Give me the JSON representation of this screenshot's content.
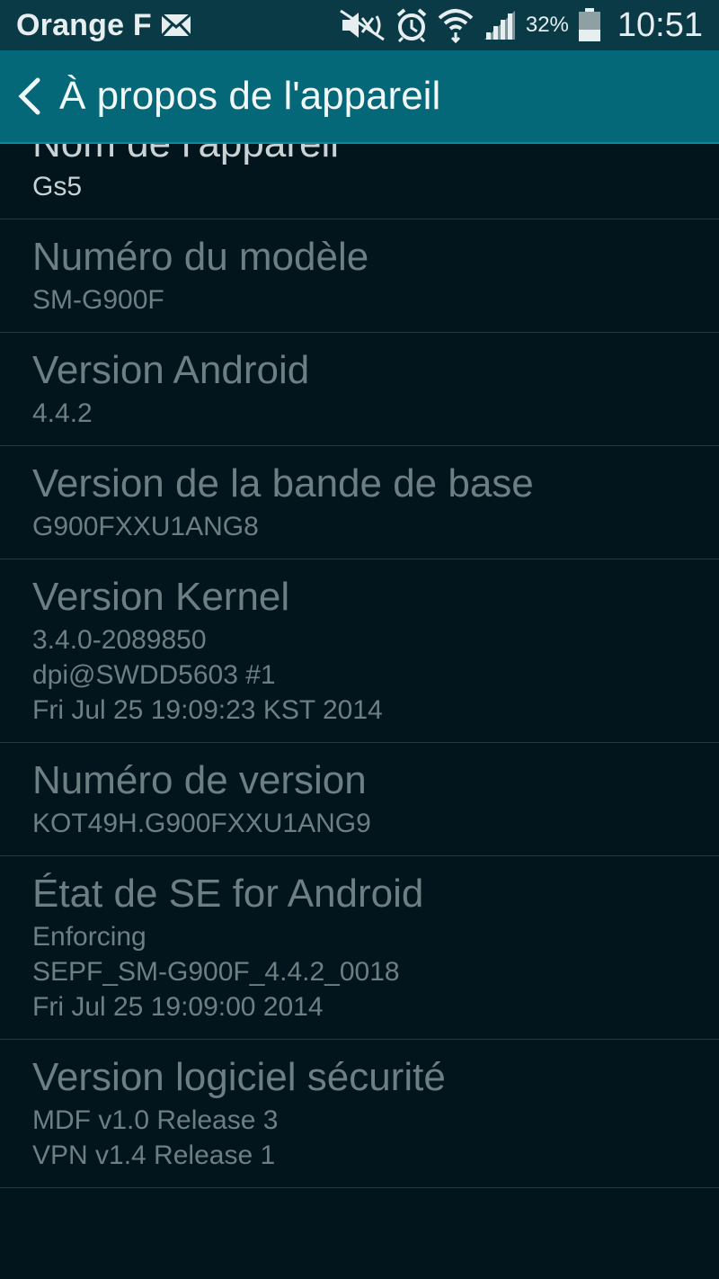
{
  "status_bar": {
    "carrier": "Orange F",
    "battery_percent": "32%",
    "time": "10:51",
    "icons": [
      "mail-icon",
      "mute-icon",
      "alarm-icon",
      "wifi-icon",
      "signal-icon",
      "battery-icon"
    ]
  },
  "app_bar": {
    "title": "À propos de l'appareil",
    "back_icon": "chevron-left-icon"
  },
  "items": [
    {
      "title": "Nom de l'appareil",
      "lines": [
        "Gs5"
      ]
    },
    {
      "title": "Numéro du modèle",
      "lines": [
        "SM-G900F"
      ]
    },
    {
      "title": "Version Android",
      "lines": [
        "4.4.2"
      ]
    },
    {
      "title": "Version de la bande de base",
      "lines": [
        "G900FXXU1ANG8"
      ]
    },
    {
      "title": "Version Kernel",
      "lines": [
        "3.4.0-2089850",
        "dpi@SWDD5603 #1",
        "Fri Jul 25 19:09:23 KST 2014"
      ]
    },
    {
      "title": "Numéro de version",
      "lines": [
        "KOT49H.G900FXXU1ANG9"
      ]
    },
    {
      "title": "État de SE for Android",
      "lines": [
        "Enforcing",
        "SEPF_SM-G900F_4.4.2_0018",
        "Fri Jul 25 19:09:00 2014"
      ]
    },
    {
      "title": "Version logiciel sécurité",
      "lines": [
        "MDF v1.0 Release 3",
        "VPN v1.4 Release 1"
      ]
    }
  ],
  "colors": {
    "status_bar_bg": "#0b3a47",
    "app_bar_bg": "#046879",
    "page_bg": "#02151c",
    "text_muted": "#6e7f84",
    "text_bright": "#c9d3d6"
  }
}
